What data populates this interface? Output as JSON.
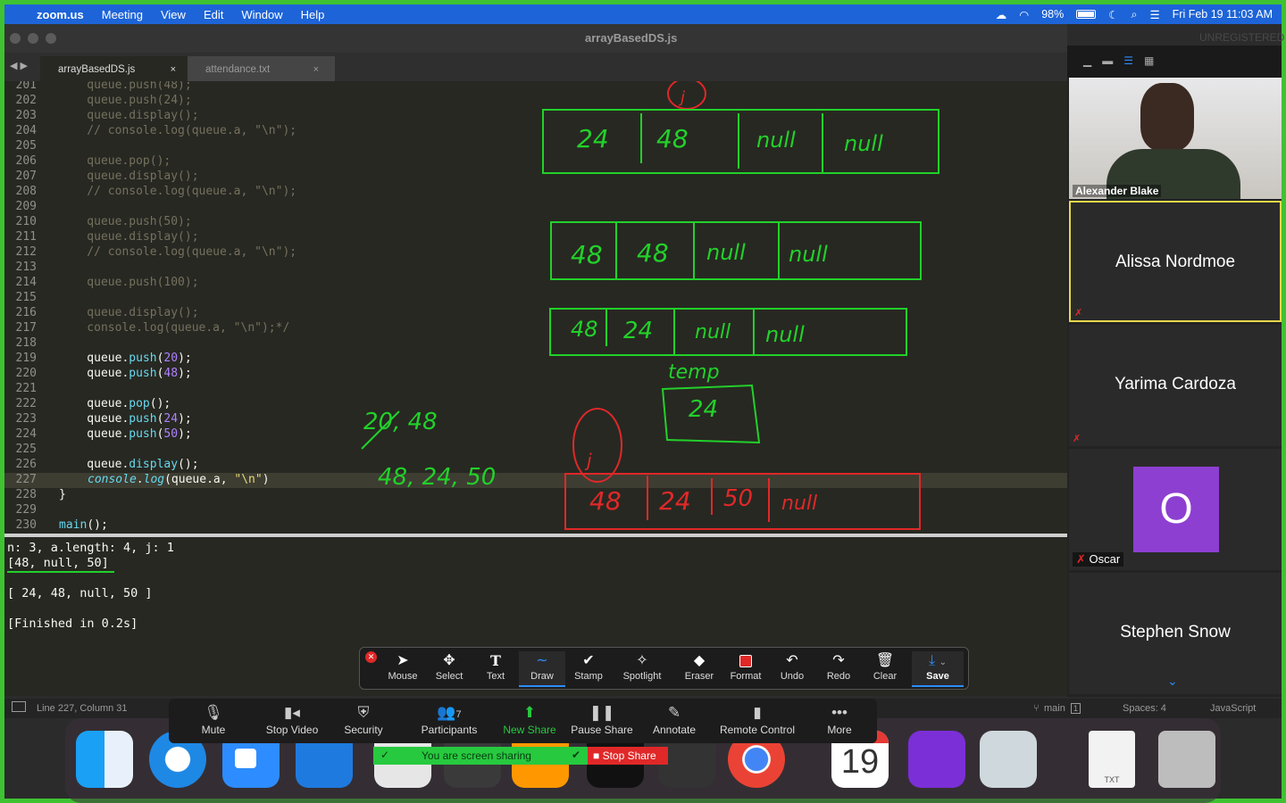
{
  "menubar": {
    "app_name": "zoom.us",
    "items": [
      "Meeting",
      "View",
      "Edit",
      "Window",
      "Help"
    ],
    "battery": "98%",
    "datetime": "Fri Feb 19  11:03 AM"
  },
  "window": {
    "title": "arrayBasedDS.js",
    "watermark": "UNREGISTERED",
    "tabs": [
      {
        "label": "arrayBasedDS.js",
        "close": "×"
      },
      {
        "label": "attendance.txt",
        "close": "×"
      }
    ]
  },
  "editor": {
    "lines": [
      {
        "n": "201",
        "text": "    queue.push(48);"
      },
      {
        "n": "202",
        "text": "    queue.push(24);"
      },
      {
        "n": "203",
        "text": "    queue.display();"
      },
      {
        "n": "204",
        "text": "    // console.log(queue.a, \"\\n\");"
      },
      {
        "n": "205",
        "text": ""
      },
      {
        "n": "206",
        "text": "    queue.pop();"
      },
      {
        "n": "207",
        "text": "    queue.display();"
      },
      {
        "n": "208",
        "text": "    // console.log(queue.a, \"\\n\");"
      },
      {
        "n": "209",
        "text": ""
      },
      {
        "n": "210",
        "text": "    queue.push(50);"
      },
      {
        "n": "211",
        "text": "    queue.display();"
      },
      {
        "n": "212",
        "text": "    // console.log(queue.a, \"\\n\");"
      },
      {
        "n": "213",
        "text": ""
      },
      {
        "n": "214",
        "text": "    queue.push(100);"
      },
      {
        "n": "215",
        "text": ""
      },
      {
        "n": "216",
        "text": "    queue.display();"
      },
      {
        "n": "217",
        "text": "    console.log(queue.a, \"\\n\");*/"
      },
      {
        "n": "218",
        "text": ""
      },
      {
        "n": "219",
        "pre": "    queue.",
        "fn": "push",
        "open": "(",
        "num": "20",
        "post": ");"
      },
      {
        "n": "220",
        "pre": "    queue.",
        "fn": "push",
        "open": "(",
        "num": "48",
        "post": ");"
      },
      {
        "n": "221",
        "text": ""
      },
      {
        "n": "222",
        "pre": "    queue.",
        "fn": "pop",
        "open": "(",
        "num": "",
        "post": ");"
      },
      {
        "n": "223",
        "pre": "    queue.",
        "fn": "push",
        "open": "(",
        "num": "24",
        "post": ");"
      },
      {
        "n": "224",
        "pre": "    queue.",
        "fn": "push",
        "open": "(",
        "num": "50",
        "post": ");"
      },
      {
        "n": "225",
        "text": ""
      },
      {
        "n": "226",
        "pre": "    queue.",
        "fn": "display",
        "open": "(",
        "num": "",
        "post": ");"
      },
      {
        "n": "227",
        "log": true
      },
      {
        "n": "228",
        "text": "}"
      },
      {
        "n": "229",
        "text": ""
      },
      {
        "n": "230",
        "main": true
      }
    ],
    "log_line": {
      "obj": "console",
      "dot": ".",
      "fn": "log",
      "args": "(queue.a, ",
      "str": "\"\\n\"",
      "close": ")"
    },
    "main_line": {
      "fn": "main",
      "rest": "();"
    }
  },
  "whiteboard": {
    "row1": [
      "24",
      "48",
      "null",
      "null"
    ],
    "row2": [
      "48",
      "48",
      "null",
      "null"
    ],
    "row3": [
      "48",
      "24",
      "null",
      "null"
    ],
    "row4": [
      "48",
      "24",
      "50",
      "null"
    ],
    "temp_label": "temp",
    "temp_value": "24",
    "j_label": "j",
    "notes_1": "20, 48",
    "notes_2": "48, 24, 50"
  },
  "output": {
    "lines": [
      "n: 3, a.length: 4, j: 1",
      "[48, null, 50]",
      "",
      "[ 24, 48, null, 50 ]",
      "",
      "[Finished in 0.2s]"
    ]
  },
  "statusbar": {
    "position": "Line 227, Column 31",
    "branch": "main",
    "branch_count": "1",
    "spaces": "Spaces: 4",
    "syntax": "JavaScript"
  },
  "annotation_toolbar": {
    "tools": [
      "Mouse",
      "Select",
      "Text",
      "Draw",
      "Stamp",
      "Spotlight",
      "Eraser",
      "Format",
      "Undo",
      "Redo",
      "Clear",
      "Save"
    ]
  },
  "zoom_controls": {
    "buttons": [
      "Mute",
      "Stop Video",
      "Security",
      "Participants",
      "New Share",
      "Pause Share",
      "Annotate",
      "Remote Control",
      "More"
    ],
    "participants_count": "7",
    "sharing_text": "You are screen sharing",
    "stop_share": "Stop Share"
  },
  "participants": {
    "video_name": "Alexander Blake",
    "tiles": [
      "Alissa Nordmoe",
      "Yarima Cardoza",
      "Oscar",
      "Stephen Snow"
    ],
    "oscar_initial": "O"
  },
  "dock": {
    "calendar_day": "19",
    "txt_label": "TXT"
  }
}
